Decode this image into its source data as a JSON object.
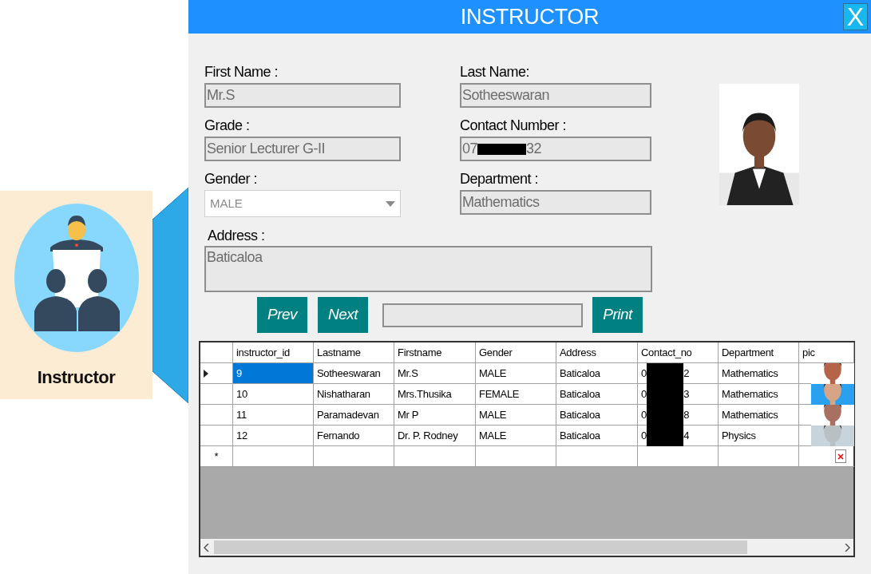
{
  "sidebar_card": {
    "label": "Instructor"
  },
  "window": {
    "title": "INSTRUCTOR",
    "close": "X"
  },
  "form": {
    "fields": [
      {
        "kind": "text",
        "label": "First Name :",
        "value": "Mr.S"
      },
      {
        "kind": "text",
        "label": "Last Name:",
        "value": "Sotheeswaran"
      },
      {
        "kind": "text",
        "label": "Grade :",
        "value": "Senior Lecturer G-II"
      },
      {
        "kind": "redacted",
        "label": "Contact Number :",
        "value_start": "07",
        "value_end": "32"
      },
      {
        "kind": "dropdown",
        "label": "Gender :",
        "value": "MALE"
      },
      {
        "kind": "text",
        "label": "Department :",
        "value": "Mathematics"
      }
    ],
    "address": {
      "label": "Address :",
      "value": "Baticaloa"
    },
    "buttons": [
      "Prev",
      "Next"
    ],
    "print_button": "Print"
  },
  "table": {
    "columns": [
      "instructor_id",
      "Lastname",
      "Firstname",
      "Gender",
      "Address",
      "Contact_no",
      "Department",
      "pic"
    ],
    "rows": [
      {
        "selected": true,
        "id": "9",
        "lastname": "Sotheeswaran",
        "firstname": "Mr.S",
        "gender": "MALE",
        "address": "Baticaloa",
        "contact_start": "0",
        "contact_end": "2",
        "department": "Mathematics"
      },
      {
        "selected": false,
        "id": "10",
        "lastname": "Nishatharan",
        "firstname": "Mrs.Thusika",
        "gender": "FEMALE",
        "address": "Baticaloa",
        "contact_start": "0",
        "contact_end": "3",
        "department": "Mathematics"
      },
      {
        "selected": false,
        "id": "11",
        "lastname": "Paramadevan",
        "firstname": "Mr  P",
        "gender": "MALE",
        "address": "Baticaloa",
        "contact_start": "0",
        "contact_end": "8",
        "department": "Mathematics"
      },
      {
        "selected": false,
        "id": "12",
        "lastname": "Fernando",
        "firstname": "Dr.  P.  Rodney",
        "gender": "MALE",
        "address": "Baticaloa",
        "contact_start": "0",
        "contact_end": "4",
        "department": "Physics"
      }
    ],
    "new_row_marker": "*"
  }
}
